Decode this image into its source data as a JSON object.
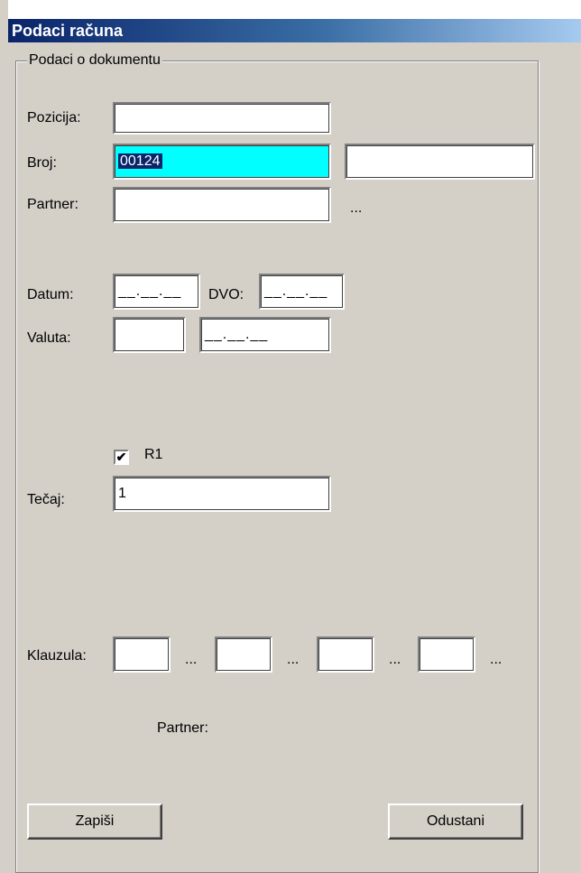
{
  "window": {
    "title": "Podaci računa"
  },
  "group": {
    "title": "Podaci o dokumentu"
  },
  "fields": {
    "pozicija": {
      "label": "Pozicija:",
      "value": ""
    },
    "broj": {
      "label": "Broj:",
      "value": "00124",
      "extra_value": ""
    },
    "partner": {
      "label": "Partner:",
      "value": "",
      "browse": "..."
    },
    "datum": {
      "label": "Datum:",
      "value": "__.__.__"
    },
    "dvo": {
      "label": "DVO:",
      "value": "__.__.__"
    },
    "valuta": {
      "label": "Valuta:",
      "value": "",
      "date_value": "__.__.__"
    },
    "r1": {
      "label": "R1",
      "checked": true,
      "mark": "✔"
    },
    "tecaj": {
      "label": "Tečaj:",
      "value": "1"
    },
    "klauzula": {
      "label": "Klauzula:",
      "values": [
        "",
        "",
        "",
        ""
      ],
      "browse": "..."
    },
    "partner_info": {
      "label": "Partner:"
    }
  },
  "buttons": {
    "save": "Zapiši",
    "cancel": "Odustani"
  },
  "colors": {
    "window_bg": "#d4d0c8",
    "highlight_field": "#00ffff",
    "titlebar_start": "#0a246a",
    "titlebar_end": "#a6caf0"
  }
}
